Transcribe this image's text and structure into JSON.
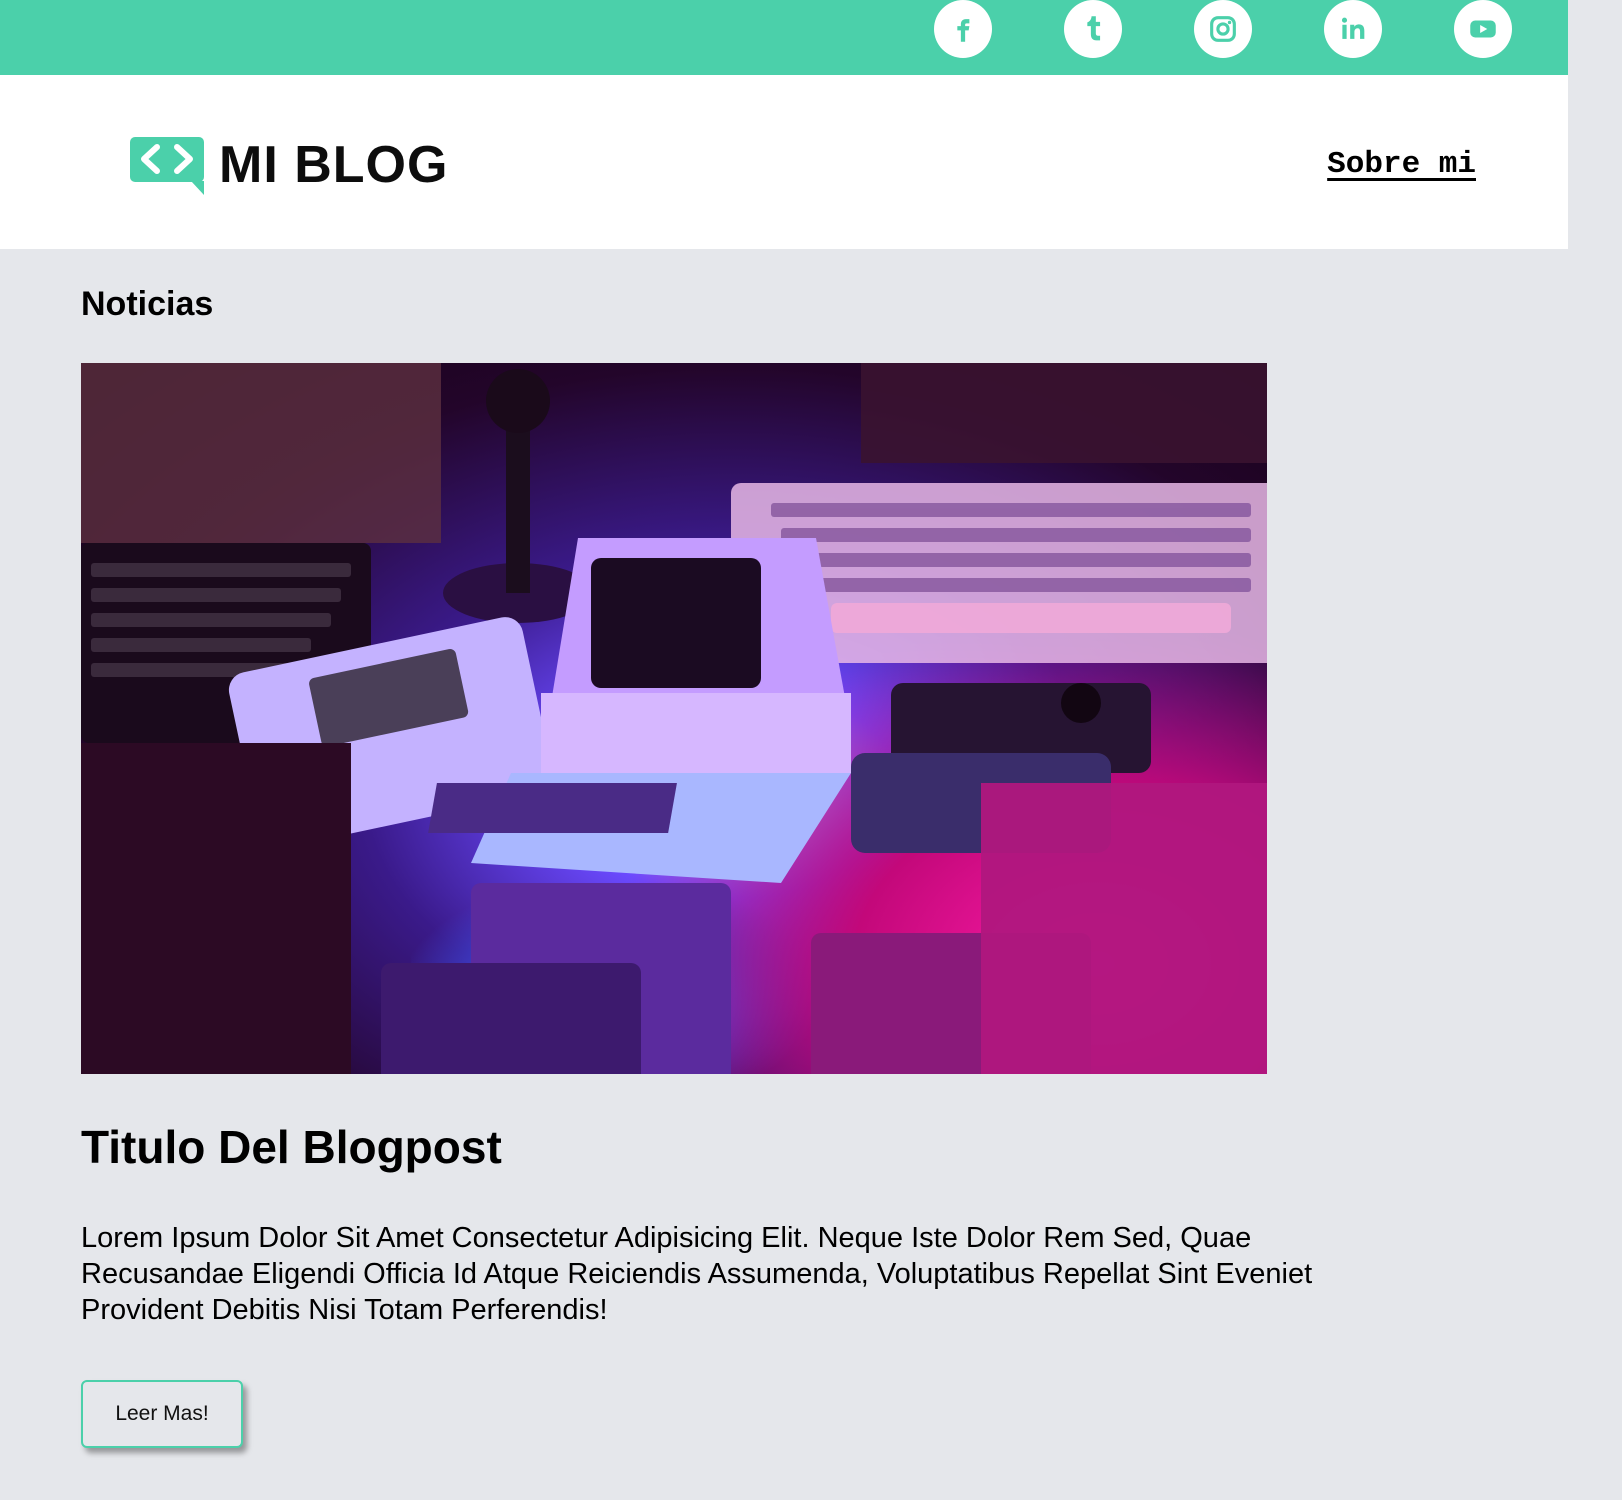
{
  "topbar": {
    "socials": [
      {
        "name": "facebook-icon"
      },
      {
        "name": "tumblr-icon"
      },
      {
        "name": "instagram-icon"
      },
      {
        "name": "linkedin-icon"
      },
      {
        "name": "youtube-icon"
      }
    ],
    "accent_color": "#4bd0aa"
  },
  "header": {
    "logo_text": "MI BLOG",
    "nav_link": "Sobre mi"
  },
  "main": {
    "section_title": "Noticias",
    "post": {
      "title": "Titulo Del Blogpost",
      "body": "Lorem Ipsum Dolor Sit Amet Consectetur Adipisicing Elit. Neque Iste Dolor Rem Sed, Quae Recusandae Eligendi Officia Id Atque Reiciendis Assumenda, Voluptatibus Repellat Sint Eveniet Provident Debitis Nisi Totam Perferendis!",
      "button_label": "Leer Mas!"
    }
  }
}
